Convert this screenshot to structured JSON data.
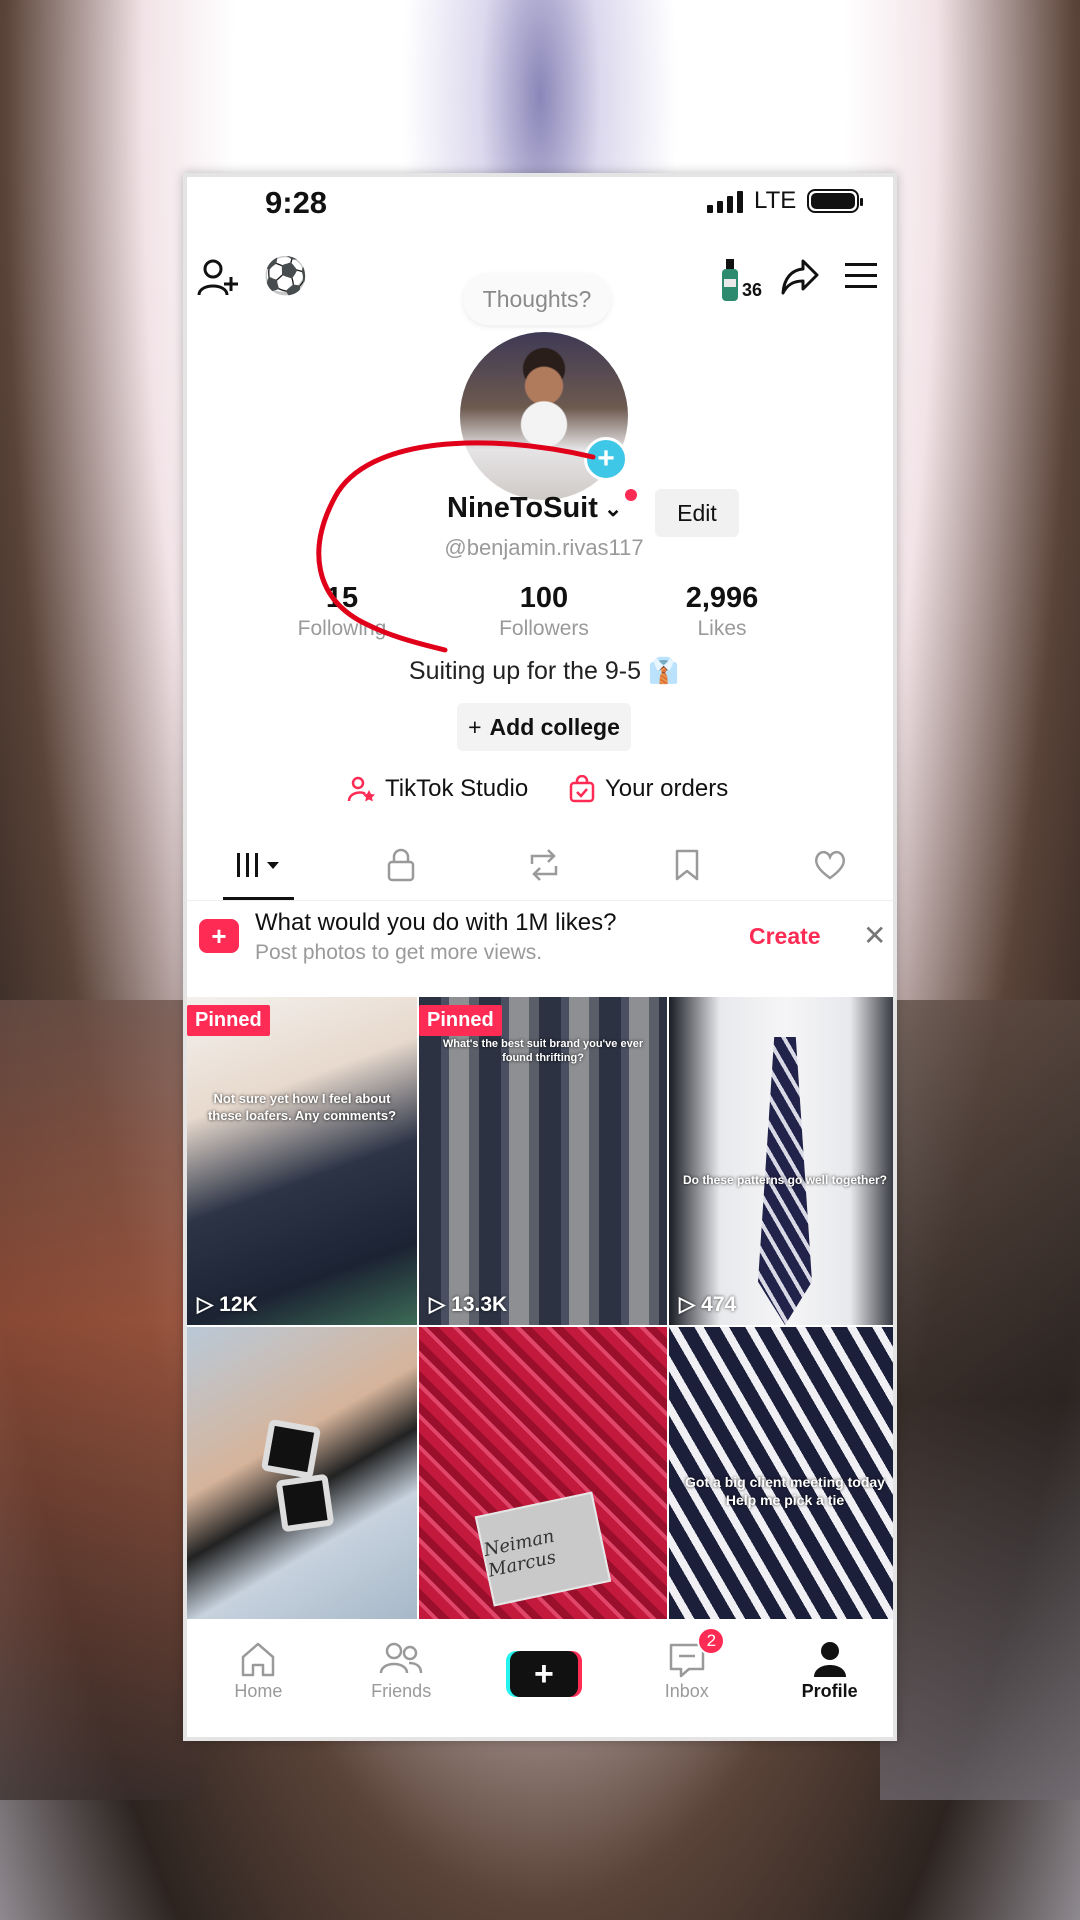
{
  "status_bar": {
    "time": "9:28",
    "network": "LTE",
    "signal_level": 4,
    "battery_level": 1.0
  },
  "top_bar": {
    "add_friend_icon": "person-plus-icon",
    "ball_emoji": "⚽",
    "streak_count": "36",
    "share_icon": "share-arrow-icon",
    "menu_icon": "hamburger-menu-icon"
  },
  "profile": {
    "thoughts_placeholder": "Thoughts?",
    "nickname": "NineToSuit",
    "handle": "@benjamin.rivas117",
    "edit_label": "Edit",
    "stats": [
      {
        "value": "15",
        "label": "Following"
      },
      {
        "value": "100",
        "label": "Followers"
      },
      {
        "value": "2,996",
        "label": "Likes"
      }
    ],
    "bio": "Suiting up for the 9-5 👔",
    "add_college_label": "Add college",
    "studio_label": "TikTok Studio",
    "orders_label": "Your orders"
  },
  "tabs": [
    {
      "name": "videos",
      "icon": "grid-bars-icon"
    },
    {
      "name": "private",
      "icon": "lock-icon"
    },
    {
      "name": "reposts",
      "icon": "repost-icon"
    },
    {
      "name": "favorites",
      "icon": "bookmark-icon"
    },
    {
      "name": "liked",
      "icon": "heart-icon"
    }
  ],
  "promo": {
    "title": "What would you do with 1M likes?",
    "subtitle": "Post photos to get more views.",
    "create_label": "Create"
  },
  "videos": [
    {
      "pinned": "Pinned",
      "overlay": "Not sure yet how I feel about these loafers. Any comments?",
      "views": "12K"
    },
    {
      "pinned": "Pinned",
      "overlay": "What's the best suit brand you've ever found thrifting?",
      "views": "13.3K"
    },
    {
      "pinned": "",
      "overlay": "Do these patterns go well together?",
      "views": "474"
    },
    {
      "pinned": "",
      "overlay": "",
      "views": ""
    },
    {
      "pinned": "",
      "overlay": "Neiman Marcus",
      "views": ""
    },
    {
      "pinned": "",
      "overlay": "Got a big client meeting today Help me pick a tie",
      "views": ""
    }
  ],
  "bottom_nav": [
    {
      "label": "Home",
      "icon": "home-icon"
    },
    {
      "label": "Friends",
      "icon": "friends-icon"
    },
    {
      "label": "",
      "icon": "create-plus-icon"
    },
    {
      "label": "Inbox",
      "icon": "inbox-icon",
      "badge": "2"
    },
    {
      "label": "Profile",
      "icon": "profile-icon"
    }
  ],
  "colors": {
    "accent": "#fe2c55",
    "avatar_plus": "#3ec7e6",
    "annotation_stroke": "#e0001a"
  }
}
